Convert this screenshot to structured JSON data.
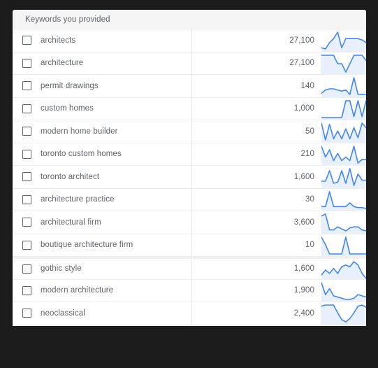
{
  "card": {
    "header_title": "Keywords you provided"
  },
  "colors": {
    "spark_line": "#4285f4",
    "spark_fill": "#e8f0fe",
    "header_bg": "#f5f5f5",
    "text": "#5f6368",
    "row_border": "#eeeeee",
    "card_bg": "#ffffff",
    "backdrop": "#1c1c1c"
  },
  "table": {
    "rows": [
      {
        "checkbox_checked": false,
        "keyword": "architects",
        "volume": "27,100",
        "section_start": false,
        "trend": [
          18,
          19,
          14,
          11,
          6,
          18,
          11,
          11,
          11,
          11,
          12,
          14
        ]
      },
      {
        "checkbox_checked": false,
        "keyword": "architecture",
        "volume": "27,100",
        "section_start": false,
        "trend": [
          4,
          4,
          4,
          4,
          12,
          12,
          20,
          12,
          4,
          4,
          4,
          9
        ]
      },
      {
        "checkbox_checked": false,
        "keyword": "permit drawings",
        "volume": "140",
        "section_start": false,
        "trend": [
          20,
          17,
          16,
          16,
          17,
          18,
          17,
          21,
          6,
          21,
          21,
          21
        ]
      },
      {
        "checkbox_checked": false,
        "keyword": "custom homes",
        "volume": "1,000",
        "section_start": false,
        "trend": [
          23,
          23,
          23,
          23,
          23,
          23,
          6,
          6,
          22,
          6,
          22,
          6
        ]
      },
      {
        "checkbox_checked": false,
        "keyword": "modern home builder",
        "volume": "50",
        "section_start": false,
        "trend": [
          5,
          20,
          6,
          19,
          12,
          19,
          10,
          19,
          9,
          18,
          5,
          9
        ]
      },
      {
        "checkbox_checked": false,
        "keyword": "toronto custom homes",
        "volume": "210",
        "section_start": false,
        "trend": [
          6,
          15,
          9,
          18,
          12,
          18,
          15,
          18,
          6,
          20,
          17,
          17
        ]
      },
      {
        "checkbox_checked": false,
        "keyword": "toronto architect",
        "volume": "1,600",
        "section_start": false,
        "trend": [
          18,
          18,
          8,
          20,
          19,
          8,
          20,
          6,
          22,
          11,
          17,
          17
        ]
      },
      {
        "checkbox_checked": false,
        "keyword": "architecture practice",
        "volume": "30",
        "section_start": false,
        "trend": [
          20,
          20,
          4,
          20,
          20,
          20,
          20,
          16,
          20,
          21,
          21,
          22
        ]
      },
      {
        "checkbox_checked": false,
        "keyword": "architectural firm",
        "volume": "3,600",
        "section_start": false,
        "trend": [
          6,
          4,
          20,
          20,
          17,
          19,
          21,
          18,
          17,
          17,
          20,
          21
        ]
      },
      {
        "checkbox_checked": false,
        "keyword": "boutique architecture firm",
        "volume": "10",
        "section_start": false,
        "trend": [
          4,
          12,
          22,
          22,
          22,
          22,
          4,
          22,
          22,
          22,
          22,
          22
        ]
      },
      {
        "checkbox_checked": false,
        "keyword": "gothic style",
        "volume": "1,600",
        "section_start": true,
        "trend": [
          20,
          17,
          19,
          16,
          19,
          15,
          14,
          15,
          12,
          14,
          19,
          22
        ]
      },
      {
        "checkbox_checked": false,
        "keyword": "modern architecture",
        "volume": "1,900",
        "section_start": false,
        "trend": [
          6,
          16,
          11,
          17,
          18,
          19,
          20,
          20,
          19,
          16,
          17,
          18
        ]
      },
      {
        "checkbox_checked": false,
        "keyword": "neoclassical",
        "volume": "2,400",
        "section_start": false,
        "trend": [
          8,
          7,
          7,
          7,
          14,
          20,
          22,
          19,
          14,
          8,
          7,
          9
        ]
      }
    ]
  }
}
